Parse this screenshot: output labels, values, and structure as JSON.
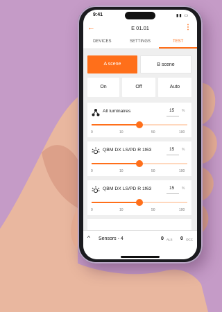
{
  "status": {
    "time": "9:41"
  },
  "appbar": {
    "title": "E 01.01"
  },
  "tabs": [
    {
      "label": "DEVICES"
    },
    {
      "label": "SETTINGS"
    },
    {
      "label": "TEST"
    }
  ],
  "scenes": {
    "a_label": "A scene",
    "b_label": "B scene"
  },
  "modes": {
    "on_label": "On",
    "off_label": "Off",
    "auto_label": "Auto"
  },
  "cards": [
    {
      "name": "All luminaires",
      "value": "15",
      "unit": "%",
      "level_fraction": 0.5,
      "ticks": [
        "0",
        "10",
        "50",
        "100"
      ]
    },
    {
      "name": "QBM DX LS/PD R 1f63",
      "value": "15",
      "unit": "%",
      "level_fraction": 0.5,
      "ticks": [
        "0",
        "10",
        "50",
        "100"
      ]
    },
    {
      "name": "QBM DX LS/PD R 1f63",
      "value": "15",
      "unit": "%",
      "level_fraction": 0.5,
      "ticks": [
        "0",
        "10",
        "50",
        "100"
      ]
    }
  ],
  "bottom": {
    "sensors_label": "Sensors - 4",
    "als_value": "0",
    "als_label": "ALS",
    "occ_value": "0",
    "occ_label": "OCC"
  },
  "colors": {
    "accent": "#ff6f1a",
    "background": "#c59bc7"
  }
}
